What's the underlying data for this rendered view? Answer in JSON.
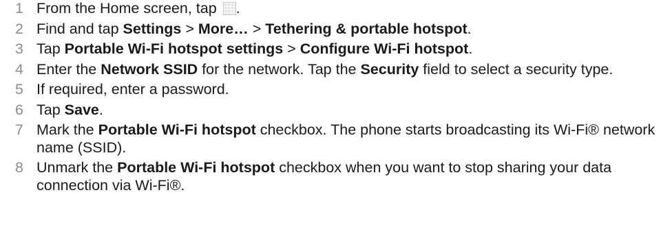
{
  "steps": [
    {
      "number": "1",
      "segments": [
        {
          "text": "From the Home screen, tap ",
          "bold": false
        },
        {
          "icon": "apps-grid-icon"
        },
        {
          "text": ".",
          "bold": false
        }
      ]
    },
    {
      "number": "2",
      "segments": [
        {
          "text": "Find and tap ",
          "bold": false
        },
        {
          "text": "Settings",
          "bold": true
        },
        {
          "text": " > ",
          "bold": false
        },
        {
          "text": "More…",
          "bold": true
        },
        {
          "text": " > ",
          "bold": false
        },
        {
          "text": "Tethering & portable hotspot",
          "bold": true
        },
        {
          "text": ".",
          "bold": false
        }
      ]
    },
    {
      "number": "3",
      "segments": [
        {
          "text": "Tap ",
          "bold": false
        },
        {
          "text": "Portable Wi-Fi hotspot settings",
          "bold": true
        },
        {
          "text": " > ",
          "bold": false
        },
        {
          "text": "Configure Wi-Fi hotspot",
          "bold": true
        },
        {
          "text": ".",
          "bold": false
        }
      ]
    },
    {
      "number": "4",
      "segments": [
        {
          "text": "Enter the ",
          "bold": false
        },
        {
          "text": "Network SSID",
          "bold": true
        },
        {
          "text": " for the network. Tap the ",
          "bold": false
        },
        {
          "text": "Security",
          "bold": true
        },
        {
          "text": " field to select a security type.",
          "bold": false
        }
      ]
    },
    {
      "number": "5",
      "segments": [
        {
          "text": "If required, enter a password.",
          "bold": false
        }
      ]
    },
    {
      "number": "6",
      "segments": [
        {
          "text": "Tap ",
          "bold": false
        },
        {
          "text": "Save",
          "bold": true
        },
        {
          "text": ".",
          "bold": false
        }
      ]
    },
    {
      "number": "7",
      "segments": [
        {
          "text": "Mark the ",
          "bold": false
        },
        {
          "text": "Portable Wi-Fi hotspot",
          "bold": true
        },
        {
          "text": " checkbox. The phone starts broadcasting its Wi-Fi® network name (SSID).",
          "bold": false
        }
      ]
    },
    {
      "number": "8",
      "segments": [
        {
          "text": "Unmark the ",
          "bold": false
        },
        {
          "text": "Portable Wi-Fi hotspot",
          "bold": true
        },
        {
          "text": " checkbox when you want to stop sharing your data connection via Wi-Fi®.",
          "bold": false
        }
      ]
    }
  ]
}
